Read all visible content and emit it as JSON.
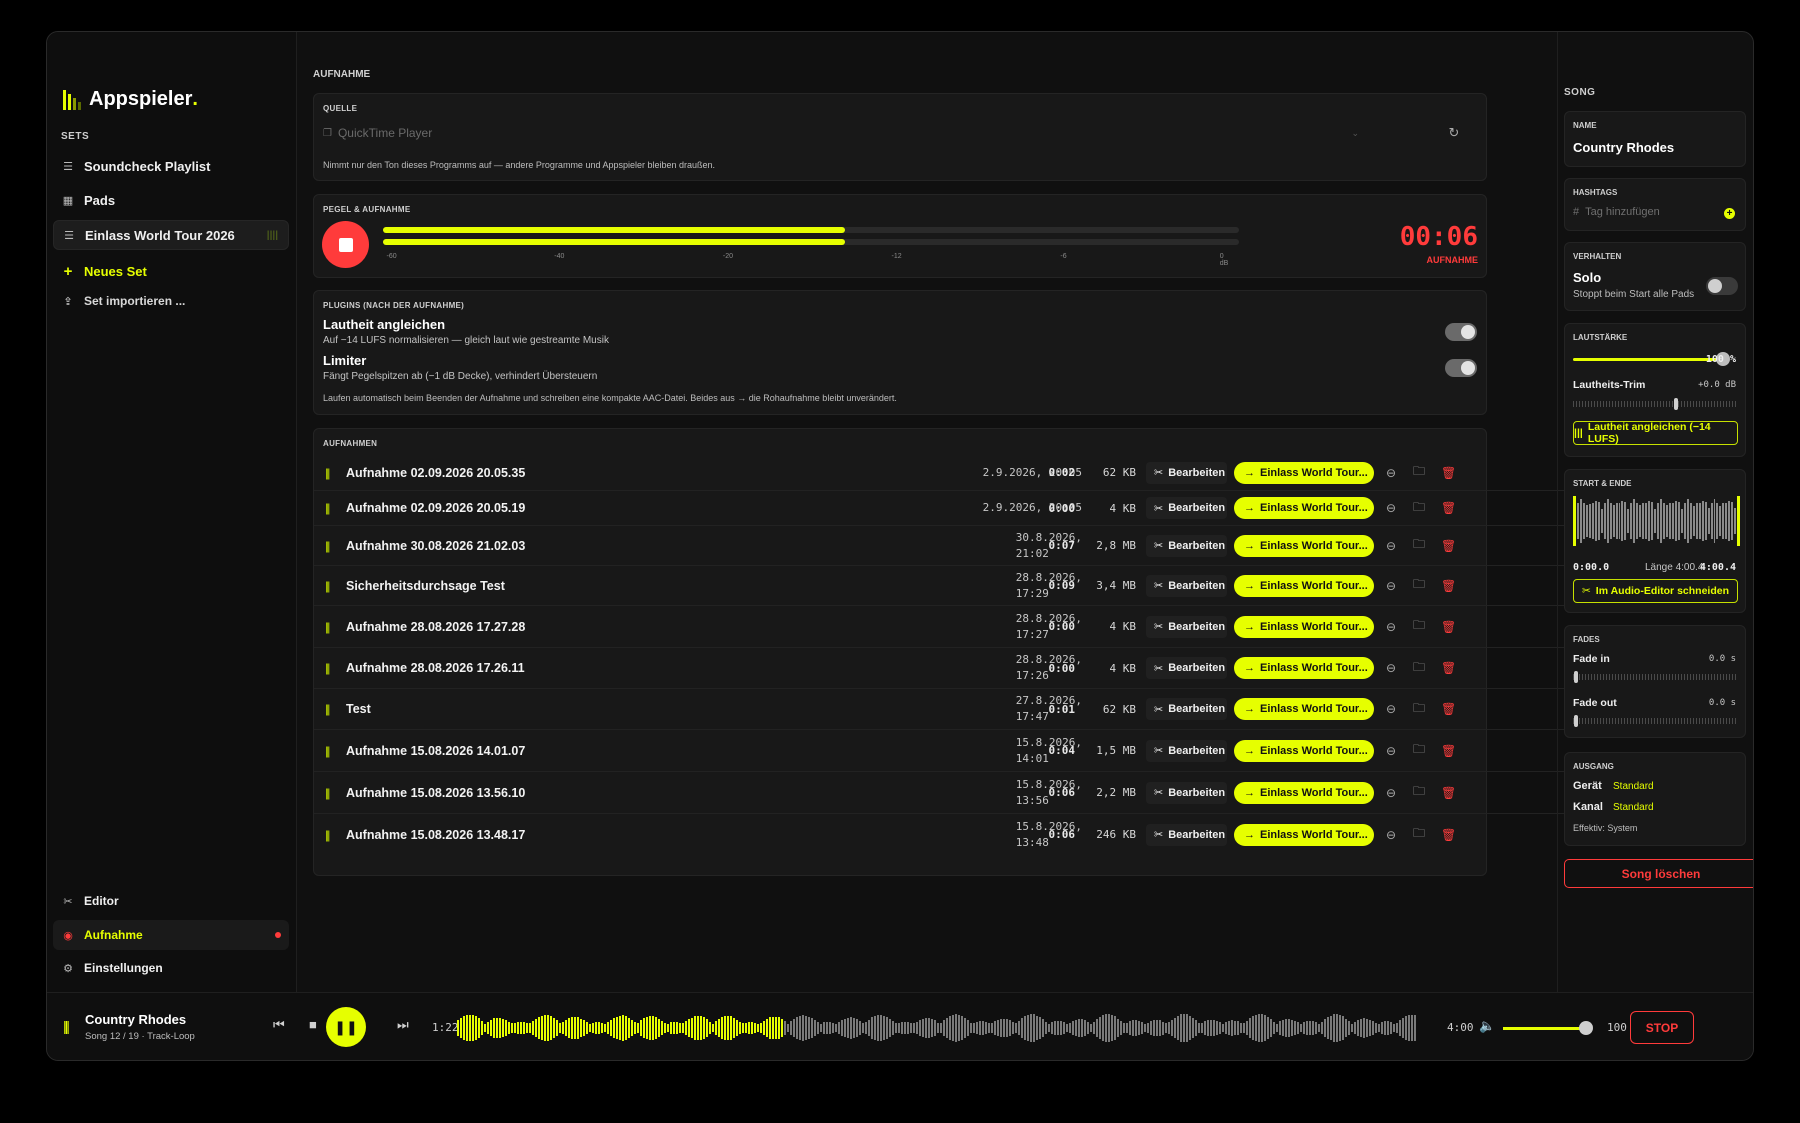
{
  "app": {
    "name_main": "Appspieler",
    "name_dot": "."
  },
  "sidebar": {
    "section": "SETS",
    "sets": [
      {
        "label": "Soundcheck Playlist",
        "icon": "list-icon"
      },
      {
        "label": "Pads",
        "icon": "grid-icon"
      },
      {
        "label": "Einlass World Tour 2026",
        "icon": "list-icon",
        "active": true
      }
    ],
    "new_set": "Neues Set",
    "import_set": "Set importieren ...",
    "nav": [
      {
        "label": "Editor",
        "icon": "scissors-icon"
      },
      {
        "label": "Aufnahme",
        "icon": "record-icon",
        "active": true
      },
      {
        "label": "Einstellungen",
        "icon": "gear-icon"
      }
    ]
  },
  "main": {
    "title": "AUFNAHME",
    "source": {
      "label": "QUELLE",
      "value": "QuickTime Player",
      "hint": "Nimmt nur den Ton dieses Programms auf — andere Programme und Appspieler bleiben draußen."
    },
    "meter": {
      "label": "PEGEL & AUFNAHME",
      "level_left": 0.54,
      "level_right": 0.54,
      "ticks": [
        "-60",
        "-40",
        "-20",
        "-12",
        "-6",
        "0 dB"
      ],
      "timer": "00:06",
      "timer_label": "AUFNAHME"
    },
    "plugins": {
      "label": "PLUGINS (NACH DER AUFNAHME)",
      "items": [
        {
          "title": "Lautheit angleichen",
          "desc": "Auf −14 LUFS normalisieren — gleich laut wie gestreamte Musik",
          "on": true
        },
        {
          "title": "Limiter",
          "desc": "Fängt Pegelspitzen ab (−1 dB Decke), verhindert Übersteuern",
          "on": true
        }
      ],
      "footer": "Laufen automatisch beim Beenden der Aufnahme und schreiben eine kompakte AAC-Datei. Beides aus → die Rohaufnahme bleibt unverändert."
    },
    "recordings": {
      "label": "AUFNAHMEN",
      "edit_label": "Bearbeiten",
      "set_label": "Einlass World Tour...",
      "rows": [
        {
          "name": "Aufnahme 02.09.2026 20.05.35",
          "date": "2.9.2026, 20:05",
          "date2": "",
          "duration": "0:02",
          "size": "62 KB"
        },
        {
          "name": "Aufnahme 02.09.2026 20.05.19",
          "date": "2.9.2026, 20:05",
          "date2": "",
          "duration": "0:00",
          "size": "4 KB"
        },
        {
          "name": "Aufnahme 30.08.2026 21.02.03",
          "date": "30.8.2026,",
          "date2": "21:02",
          "duration": "0:07",
          "size": "2,8 MB"
        },
        {
          "name": "Sicherheitsdurchsage Test",
          "date": "28.8.2026,",
          "date2": "17:29",
          "duration": "0:09",
          "size": "3,4 MB"
        },
        {
          "name": "Aufnahme 28.08.2026 17.27.28",
          "date": "28.8.2026,",
          "date2": "17:27",
          "duration": "0:00",
          "size": "4 KB"
        },
        {
          "name": "Aufnahme 28.08.2026 17.26.11",
          "date": "28.8.2026,",
          "date2": "17:26",
          "duration": "0:00",
          "size": "4 KB"
        },
        {
          "name": "Test",
          "date": "27.8.2026,",
          "date2": "17:47",
          "duration": "0:01",
          "size": "62 KB"
        },
        {
          "name": "Aufnahme 15.08.2026 14.01.07",
          "date": "15.8.2026,",
          "date2": "14:01",
          "duration": "0:04",
          "size": "1,5 MB"
        },
        {
          "name": "Aufnahme 15.08.2026 13.56.10",
          "date": "15.8.2026,",
          "date2": "13:56",
          "duration": "0:06",
          "size": "2,2 MB"
        },
        {
          "name": "Aufnahme 15.08.2026 13.48.17",
          "date": "15.8.2026,",
          "date2": "13:48",
          "duration": "0:06",
          "size": "246 KB"
        }
      ]
    }
  },
  "song": {
    "title": "SONG",
    "name_label": "NAME",
    "name": "Country Rhodes",
    "hashtags_label": "HASHTAGS",
    "hashtags_placeholder": "Tag hinzufügen",
    "behavior_label": "VERHALTEN",
    "solo_title": "Solo",
    "solo_desc": "Stoppt beim Start alle Pads",
    "solo_on": false,
    "volume_label": "LAUTSTÄRKE",
    "volume_value": "100 %",
    "volume_level": 1.0,
    "trim_label": "Lautheits-Trim",
    "trim_value": "+0.0 dB",
    "loudness_button": "Lautheit angleichen (−14 LUFS)",
    "startend_label": "START & ENDE",
    "start_time": "0:00.0",
    "length_text": "Länge 4:00.4",
    "end_time": "4:00.4",
    "cut_button": "Im Audio-Editor schneiden",
    "fades_label": "FADES",
    "fade_in_label": "Fade in",
    "fade_in_value": "0.0 s",
    "fade_out_label": "Fade out",
    "fade_out_value": "0.0 s",
    "output_label": "AUSGANG",
    "device_label": "Gerät",
    "device_value": "Standard",
    "channel_label": "Kanal",
    "channel_value": "Standard",
    "effective_text": "Effektiv: System",
    "delete_button": "Song löschen"
  },
  "player": {
    "title": "Country Rhodes",
    "subtitle": "Song 12 / 19 · Track-Loop",
    "elapsed": "1:22",
    "total": "4:00",
    "progress": 0.34,
    "volume": "100",
    "stop_label": "STOP"
  },
  "colors": {
    "accent": "#e6ff00",
    "record": "#ff3b3b",
    "background": "#101010",
    "panel": "#181818"
  }
}
